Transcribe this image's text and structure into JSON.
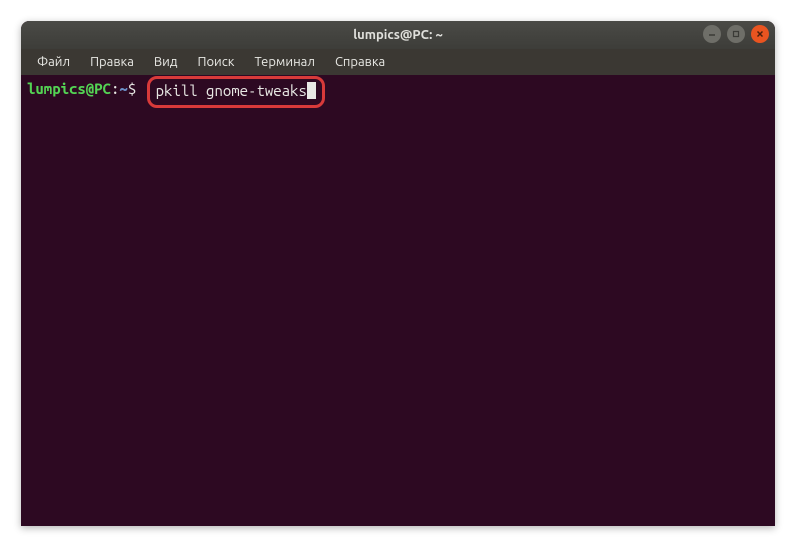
{
  "window": {
    "title": "lumpics@PC: ~"
  },
  "menubar": {
    "items": [
      {
        "label": "Файл"
      },
      {
        "label": "Правка"
      },
      {
        "label": "Вид"
      },
      {
        "label": "Поиск"
      },
      {
        "label": "Терминал"
      },
      {
        "label": "Справка"
      }
    ]
  },
  "terminal": {
    "prompt_user": "lumpics@PC",
    "prompt_colon": ":",
    "prompt_path": "~",
    "prompt_dollar": "$",
    "command": "pkill gnome-tweaks"
  }
}
